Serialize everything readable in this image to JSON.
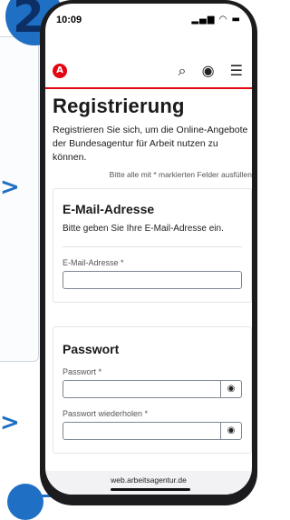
{
  "step": {
    "number": "2"
  },
  "status_bar": {
    "time": "10:09",
    "icons": "..ıl ≋ ▬"
  },
  "appbar": {
    "logo_letter": "A"
  },
  "page": {
    "title": "Registrierung",
    "intro": "Registrieren Sie sich, um die Online-Angebote der Bundesagentur für Arbeit nutzen zu können.",
    "required_note": "Bitte alle mit * markierten Felder ausfüllen"
  },
  "email_section": {
    "heading": "E-Mail-Adresse",
    "description": "Bitte geben Sie Ihre E-Mail-Adresse ein.",
    "field_label": "E-Mail-Adresse *",
    "value": ""
  },
  "password_section": {
    "heading": "Passwort",
    "field_label": "Passwort *",
    "repeat_label": "Passwort wiederholen *"
  },
  "browser": {
    "url": "web.arbeitsagentur.de"
  }
}
